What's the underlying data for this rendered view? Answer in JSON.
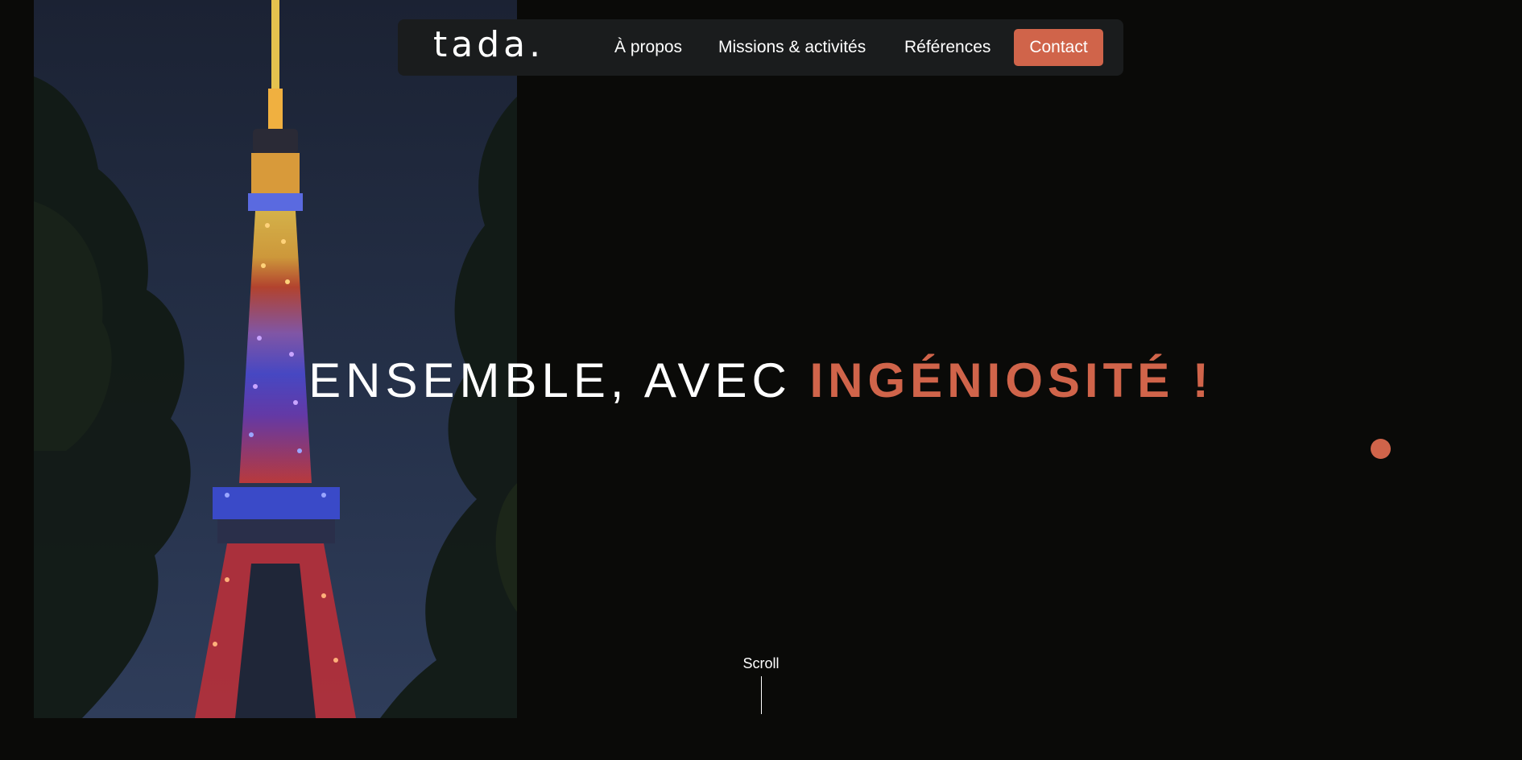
{
  "nav": {
    "logo": "tada.",
    "links": [
      "À propos",
      "Missions & activités",
      "Références"
    ],
    "contact_label": "Contact"
  },
  "hero": {
    "headline_part1": "ENSEMBLE, AVEC ",
    "headline_part2": "INGÉNIOSITÉ !",
    "scroll_label": "Scroll",
    "image_subject": "Tokyo Tower illuminated at night framed by trees"
  },
  "colors": {
    "background": "#0a0a08",
    "accent": "#d0644a",
    "navbar": "#1a1c1d",
    "text": "#ffffff"
  },
  "icons": {
    "cursor": "cursor-dot-icon"
  }
}
